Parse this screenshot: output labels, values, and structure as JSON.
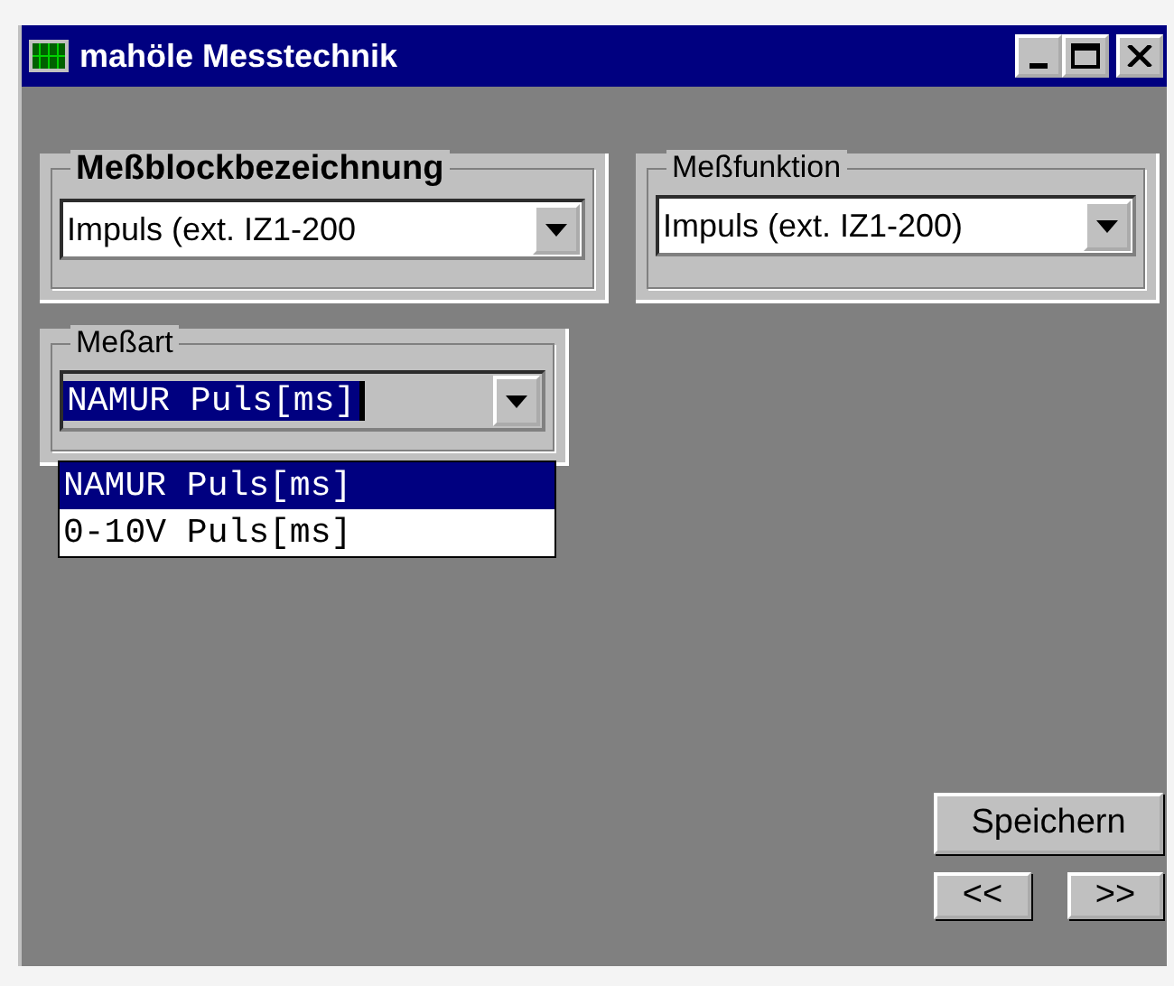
{
  "window": {
    "title": "mahöle Messtechnik"
  },
  "groups": [
    {
      "label": "Meßblockbezeichnung",
      "bold": true,
      "value": "Impuls (ext. IZ1-200"
    },
    {
      "label": "Meßfunktion",
      "bold": false,
      "value": "Impuls (ext. IZ1-200)"
    }
  ],
  "measure_type": {
    "label": "Meßart",
    "value": "NAMUR Puls[ms]",
    "expanded": true,
    "options": [
      {
        "label": "NAMUR Puls[ms]",
        "selected": true
      },
      {
        "label": "0-10V Puls[ms]",
        "selected": false
      }
    ]
  },
  "buttons": {
    "save": "Speichern",
    "previous": "<<",
    "next": ">>"
  }
}
